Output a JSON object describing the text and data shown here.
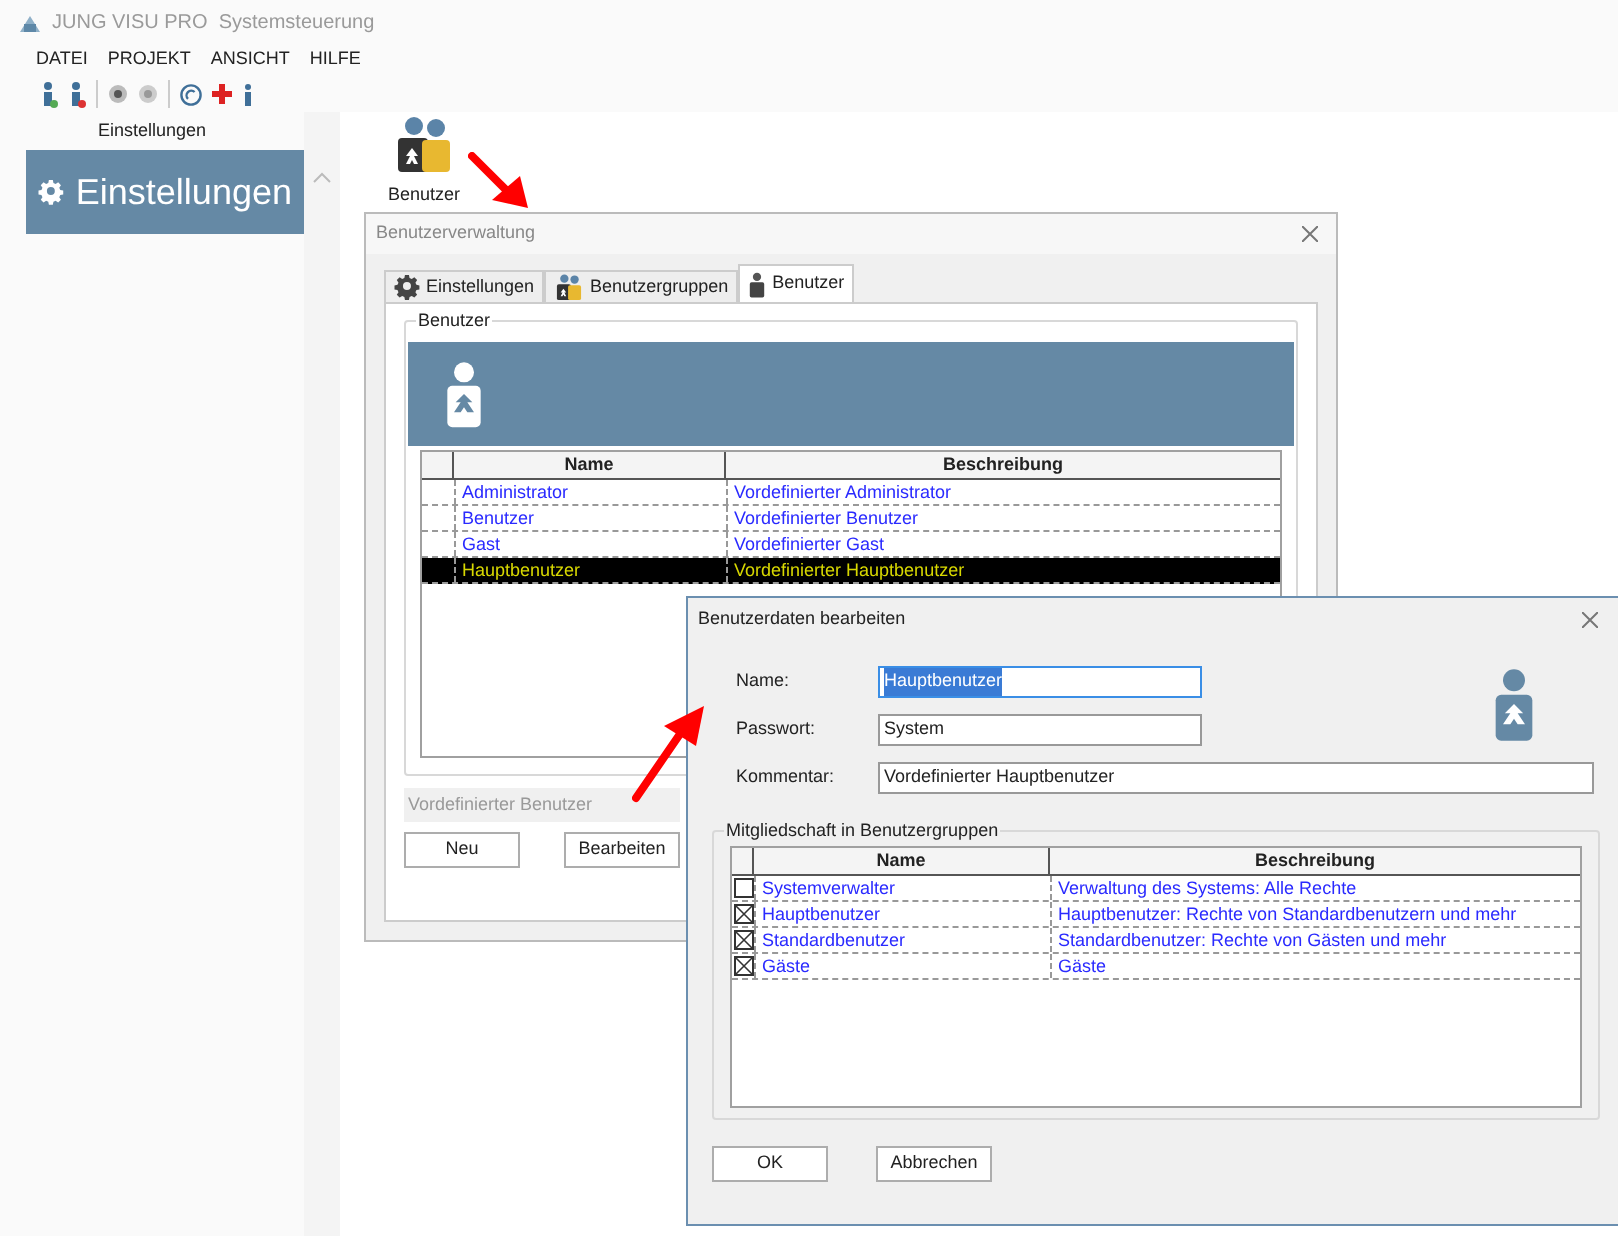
{
  "window": {
    "title": "JUNG VISU PRO  Systemsteuerung"
  },
  "menu": [
    "DATEI",
    "PROJEKT",
    "ANSICHT",
    "HILFE"
  ],
  "sidebar": {
    "header": "Einstellungen",
    "items": [
      {
        "label": "Einstellungen",
        "selected": true
      }
    ]
  },
  "launcher": {
    "label": "Benutzer"
  },
  "user_dialog": {
    "title": "Benutzerverwaltung",
    "tabs": [
      {
        "label": "Einstellungen",
        "selected": false
      },
      {
        "label": "Benutzergruppen",
        "selected": false
      },
      {
        "label": "Benutzer",
        "selected": true
      }
    ],
    "group_title": "Benutzer",
    "columns": [
      "Name",
      "Beschreibung"
    ],
    "rows": [
      {
        "name": "Administrator",
        "description": "Vordefinierter Administrator",
        "selected": false
      },
      {
        "name": "Benutzer",
        "description": "Vordefinierter Benutzer",
        "selected": false
      },
      {
        "name": "Gast",
        "description": "Vordefinierter Gast",
        "selected": false
      },
      {
        "name": "Hauptbenutzer",
        "description": "Vordefinierter Hauptbenutzer",
        "selected": true
      }
    ],
    "status": "Vordefinierter Benutzer",
    "buttons": [
      "Neu",
      "Bearbeiten"
    ]
  },
  "edit_dialog": {
    "title": "Benutzerdaten bearbeiten",
    "fields": [
      {
        "label": "Name:",
        "value": "Hauptbenutzer",
        "focused": true
      },
      {
        "label": "Passwort:",
        "value": "System",
        "focused": false
      },
      {
        "label": "Kommentar:",
        "value": "Vordefinierter Hauptbenutzer",
        "focused": false
      }
    ],
    "group_title": "Mitgliedschaft in Benutzergruppen",
    "columns": [
      "Name",
      "Beschreibung"
    ],
    "rows": [
      {
        "checked": false,
        "name": "Systemverwalter",
        "description": "Verwaltung des Systems: Alle Rechte"
      },
      {
        "checked": true,
        "name": "Hauptbenutzer",
        "description": "Hauptbenutzer:  Rechte von Standardbenutzern und mehr"
      },
      {
        "checked": true,
        "name": "Standardbenutzer",
        "description": "Standardbenutzer: Rechte von Gästen und mehr"
      },
      {
        "checked": true,
        "name": "Gäste",
        "description": "Gäste"
      }
    ],
    "buttons": [
      "OK",
      "Abbrechen"
    ]
  }
}
